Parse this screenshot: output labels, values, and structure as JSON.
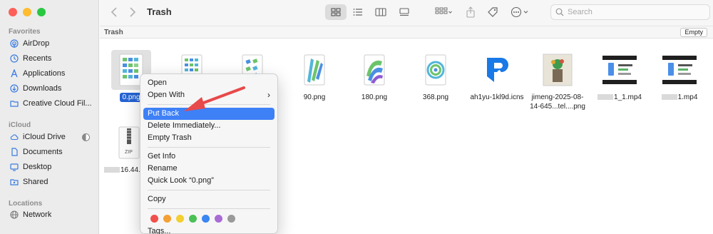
{
  "window": {
    "title": "Trash"
  },
  "sidebar": {
    "favorites_label": "Favorites",
    "favorites": [
      {
        "label": "AirDrop",
        "icon": "airdrop-icon"
      },
      {
        "label": "Recents",
        "icon": "clock-icon"
      },
      {
        "label": "Applications",
        "icon": "applications-icon"
      },
      {
        "label": "Downloads",
        "icon": "download-icon"
      },
      {
        "label": "Creative Cloud Fil...",
        "icon": "folder-icon"
      }
    ],
    "icloud_label": "iCloud",
    "icloud": [
      {
        "label": "iCloud Drive",
        "icon": "cloud-icon"
      },
      {
        "label": "Documents",
        "icon": "document-icon"
      },
      {
        "label": "Desktop",
        "icon": "desktop-icon"
      },
      {
        "label": "Shared",
        "icon": "shared-folder-icon"
      }
    ],
    "locations_label": "Locations",
    "locations": [
      {
        "label": "Network",
        "icon": "globe-icon"
      }
    ]
  },
  "toolbar": {
    "search_placeholder": "Search"
  },
  "pathbar": {
    "label": "Trash",
    "empty_button": "Empty"
  },
  "files": [
    {
      "name": "0.png",
      "selected": true
    },
    {
      "name": ""
    },
    {
      "name": ""
    },
    {
      "name": "90.png"
    },
    {
      "name": "180.png"
    },
    {
      "name": "368.png"
    },
    {
      "name": "ah1yu-1kl9d.icns"
    },
    {
      "name": "jimeng-2025-08-14-645...tel....png"
    },
    {
      "name": "1_1.mp4"
    },
    {
      "name": "1.mp4"
    },
    {
      "name": "16.44."
    }
  ],
  "zip_label": "ZIP",
  "context_menu": {
    "items_group1": [
      "Open",
      "Open With"
    ],
    "items_group2": [
      "Put Back",
      "Delete Immediately...",
      "Empty Trash"
    ],
    "items_group3": [
      "Get Info",
      "Rename",
      "Quick Look “0.png”"
    ],
    "items_group4": [
      "Copy"
    ],
    "tags_label": "Tags...",
    "tag_colors": [
      "#f0504a",
      "#f5a033",
      "#f3cf2f",
      "#4ac057",
      "#3a86f2",
      "#a96bd6",
      "#9a9a9a"
    ]
  },
  "colors": {
    "selection": "#2463d4",
    "menu_highlight": "#3e80f6",
    "annotation_arrow": "#e8494a"
  }
}
